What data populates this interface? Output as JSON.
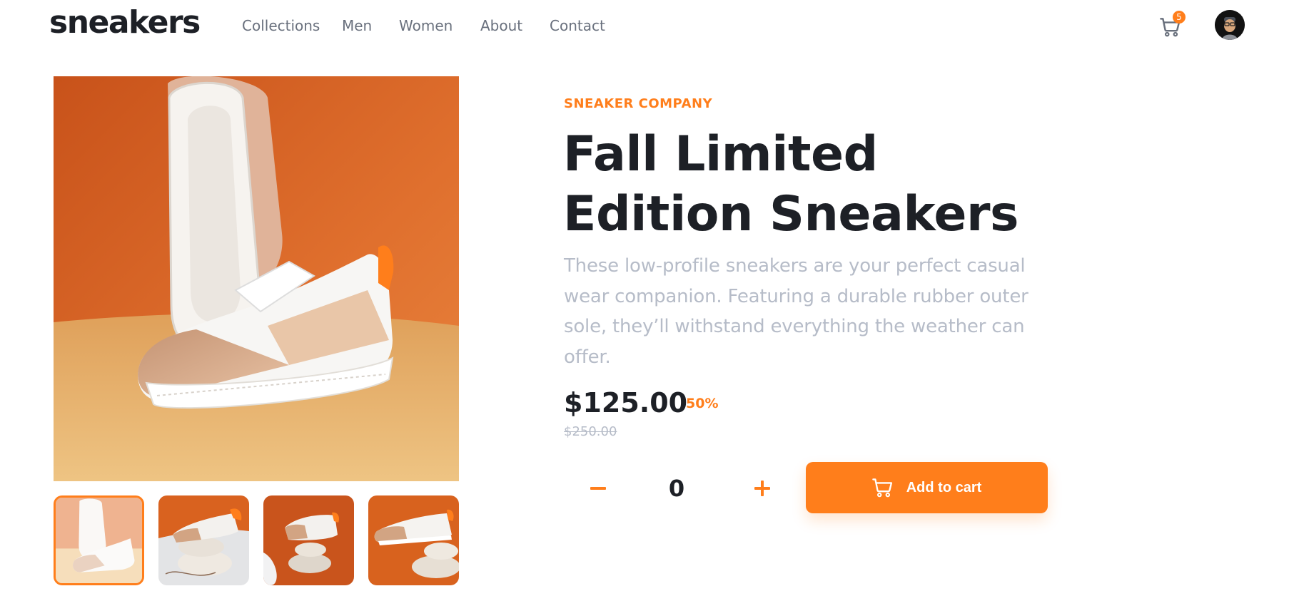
{
  "brand": {
    "logo": "sneakers"
  },
  "nav": {
    "items": [
      {
        "label": "Collections"
      },
      {
        "label": "Men"
      },
      {
        "label": "Women"
      },
      {
        "label": "About"
      },
      {
        "label": "Contact"
      }
    ]
  },
  "cart": {
    "count": "5",
    "icon": "cart-icon"
  },
  "user": {
    "icon": "avatar"
  },
  "gallery": {
    "main_image": "sneaker-product-photo",
    "thumbnails": [
      {
        "icon": "thumbnail-1",
        "selected": true
      },
      {
        "icon": "thumbnail-2",
        "selected": false
      },
      {
        "icon": "thumbnail-3",
        "selected": false
      },
      {
        "icon": "thumbnail-4",
        "selected": false
      }
    ]
  },
  "product": {
    "company": "SNEAKER COMPANY",
    "title": "Fall Limited Edition Sneakers",
    "description": "These low-profile sneakers are your perfect casual wear companion. Featuring a durable rubber outer sole, they’ll withstand everything the weather can offer.",
    "price": "$125.00",
    "discount": "50%",
    "original_price": "$250.00"
  },
  "quantity": {
    "value": "0"
  },
  "actions": {
    "add_to_cart": "Add to cart"
  },
  "colors": {
    "accent": "#ff7e1b",
    "text_dark": "#1d2026",
    "text_muted": "#b6bcc8",
    "nav_text": "#69707d"
  }
}
